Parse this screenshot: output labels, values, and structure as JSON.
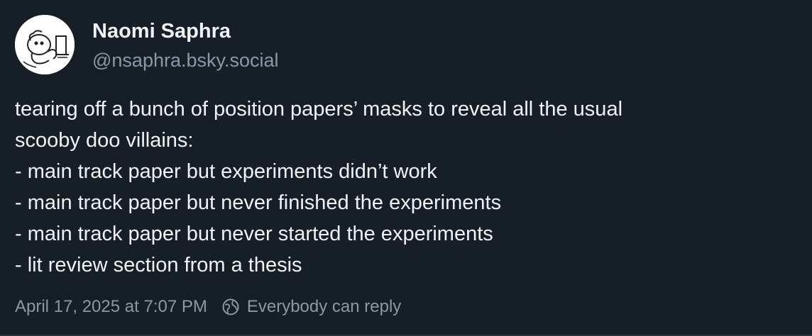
{
  "author": {
    "display_name": "Naomi Saphra",
    "handle": "@nsaphra.bsky.social",
    "avatar_icon": "cartoon-avatar-icon"
  },
  "post": {
    "lines": [
      "tearing off a bunch of position papers’ masks to reveal all the usual",
      "scooby doo villains:",
      "- main track paper but experiments didn’t work",
      "- main track paper but never finished the experiments",
      "- main track paper but never started the experiments",
      "- lit review section from a thesis"
    ],
    "timestamp": "April 17, 2025 at 7:07 PM",
    "reply_setting": "Everybody can reply",
    "reply_icon": "globe-reply-icon"
  },
  "colors": {
    "background": "#161e27",
    "primary_text": "#f1f3f5",
    "secondary_text": "#8b98a5"
  }
}
